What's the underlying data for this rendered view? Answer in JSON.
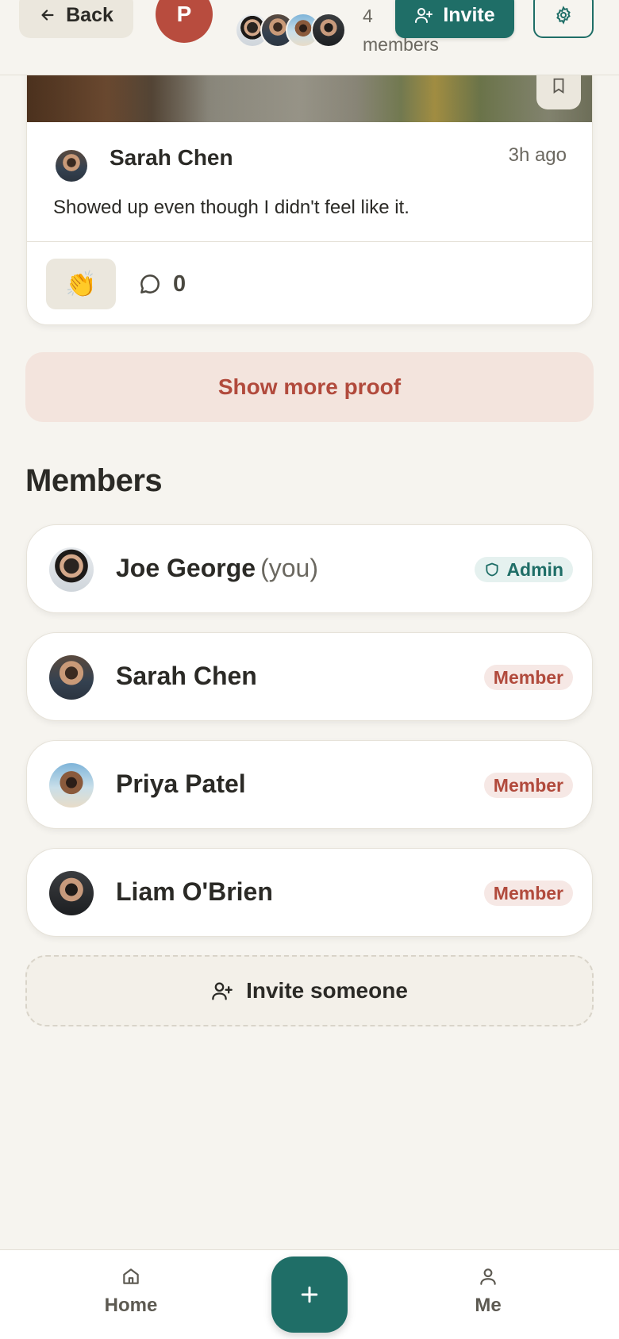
{
  "header": {
    "back_label": "Back",
    "group_initial": "P",
    "member_count": "4",
    "member_count_label": "members",
    "invite_label": "Invite",
    "colors": {
      "accent": "#1f6e67",
      "group_avatar": "#b84c3e"
    }
  },
  "post": {
    "author": "Sarah Chen",
    "time": "3h ago",
    "text": "Showed up even though I didn't feel like it.",
    "reaction_emoji": "👏",
    "comment_count": "0"
  },
  "show_more_label": "Show more proof",
  "members_section": {
    "title": "Members",
    "members": [
      {
        "name": "Joe George",
        "you_label": "(you)",
        "role": "Admin"
      },
      {
        "name": "Sarah Chen",
        "role": "Member"
      },
      {
        "name": "Priya Patel",
        "role": "Member"
      },
      {
        "name": "Liam O'Brien",
        "role": "Member"
      }
    ],
    "invite_label": "Invite someone"
  },
  "nav": {
    "home_label": "Home",
    "me_label": "Me"
  },
  "icons": [
    "arrow-left-icon",
    "user-plus-icon",
    "gear-icon",
    "bookmark-icon",
    "comment-icon",
    "shield-icon",
    "home-icon",
    "user-icon",
    "plus-icon"
  ]
}
